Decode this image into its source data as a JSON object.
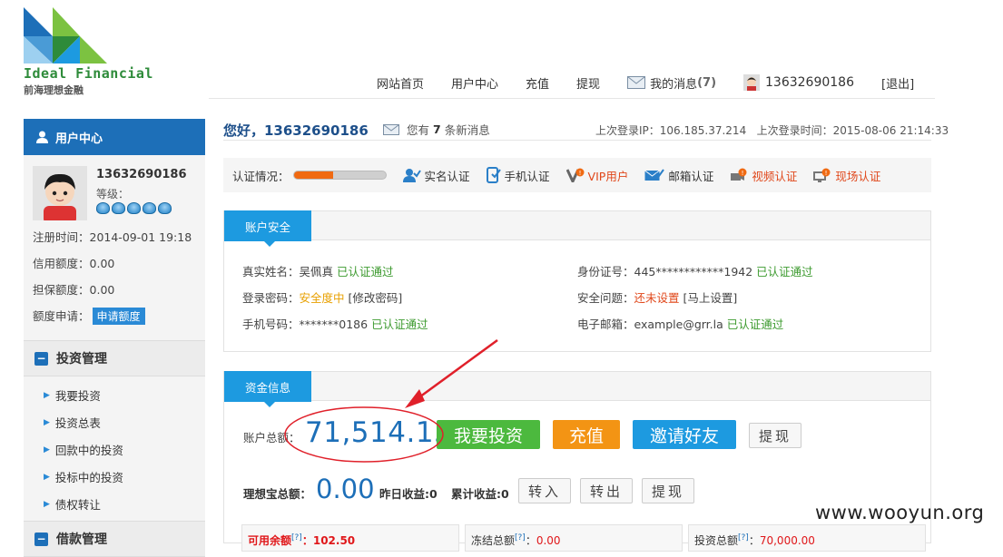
{
  "brand": {
    "name_en": "Ideal Financial",
    "name_cn": "前海理想金融",
    "colors": {
      "green": "#2e8b3a",
      "blue": "#1d6fb8",
      "light_blue": "#1d9ae0",
      "orange": "#f39414"
    }
  },
  "topnav": {
    "items": [
      "网站首页",
      "用户中心",
      "充值",
      "提现"
    ],
    "messages_label": "我的消息",
    "messages_count": "(7)",
    "username": "13632690186",
    "logout": "[退出]",
    "icons": [
      "mail-icon",
      "user-avatar-icon"
    ]
  },
  "sidebar": {
    "title": "用户中心",
    "username": "13632690186",
    "level_label": "等级：",
    "level_stars": 5,
    "register_time": "注册时间：2014-09-01 19:18",
    "credit_limit_label": "信用额度：",
    "credit_limit_value": "0.00",
    "guarantee_limit_label": "担保额度：",
    "guarantee_limit_value": "0.00",
    "limit_apply_label": "额度申请：",
    "limit_apply_button": "申请额度",
    "section_invest": "投资管理",
    "invest_links": [
      "我要投资",
      "投资总表",
      "回款中的投资",
      "投标中的投资",
      "债权转让"
    ],
    "section_loan": "借款管理"
  },
  "greeting": {
    "hello": "您好，13632690186",
    "new_msg_prefix": "您有",
    "new_msg_count": "7",
    "new_msg_suffix": "条新消息",
    "last_login": "上次登录IP：106.185.37.214   上次登录时间：2015-08-06 21:14:33"
  },
  "verification": {
    "label": "认证情况：",
    "progress": 0.43,
    "items": [
      {
        "label": "实名认证",
        "status": "ok",
        "icon": "user-check-icon"
      },
      {
        "label": "手机认证",
        "status": "ok",
        "icon": "phone-check-icon"
      },
      {
        "label": "VIP用户",
        "status": "bad",
        "icon": "vip-icon"
      },
      {
        "label": "邮箱认证",
        "status": "ok",
        "icon": "mail-check-icon"
      },
      {
        "label": "视频认证",
        "status": "bad",
        "icon": "video-icon"
      },
      {
        "label": "现场认证",
        "status": "bad",
        "icon": "onsite-icon"
      }
    ]
  },
  "security": {
    "tab": "账户安全",
    "real_name_label": "真实姓名：",
    "real_name": "吴佩真",
    "real_name_status": "已认证通过",
    "id_label": "身份证号：",
    "id_value": "445************1942",
    "id_status": "已认证通过",
    "pwd_label": "登录密码：",
    "pwd_status": "安全度中",
    "pwd_action": "[修改密码]",
    "question_label": "安全问题：",
    "question_status": "还未设置",
    "question_action": "[马上设置]",
    "phone_label": "手机号码：",
    "phone_value": "*******0186",
    "phone_status": "已认证通过",
    "email_label": "电子邮箱：",
    "email_value": "example@grr.la",
    "email_status": "已认证通过"
  },
  "funds": {
    "tab": "资金信息",
    "total_label": "账户总额：",
    "total_amount": "71,514.13",
    "btn_invest": "我要投资",
    "btn_recharge": "充值",
    "btn_invite": "邀请好友",
    "btn_withdraw": "提现",
    "lixiangbao_label": "理想宝总额：",
    "lixiangbao_amount": "0.00",
    "yesterday_income": "昨日收益:0",
    "cumulative_income": "累计收益:0",
    "btn_in": "转入",
    "btn_out": "转出",
    "btn_withdraw2": "提现",
    "available_label": "可用余额",
    "available_value": "102.50",
    "frozen_label": "冻结总额",
    "frozen_value": "0.00",
    "invested_label": "投资总额",
    "invested_value": "70,000.00",
    "help_mark": "[?]"
  },
  "watermark": "www.wooyun.org"
}
